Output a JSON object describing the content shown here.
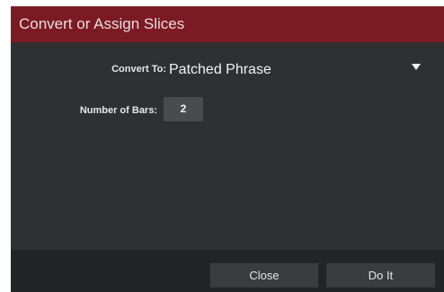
{
  "dialog": {
    "title": "Convert or Assign Slices",
    "convert_to": {
      "label": "Convert To:",
      "value": "Patched Phrase"
    },
    "number_of_bars": {
      "label": "Number of Bars:",
      "value": "2"
    },
    "buttons": {
      "close": "Close",
      "do_it": "Do It"
    }
  },
  "colors": {
    "title_bar": "#7c1a24",
    "body": "#2f3031",
    "footer": "#232425",
    "button": "#3b3c3e",
    "field": "#4a4b4d"
  },
  "icons": {
    "dropdown": "triangle-down-icon"
  }
}
